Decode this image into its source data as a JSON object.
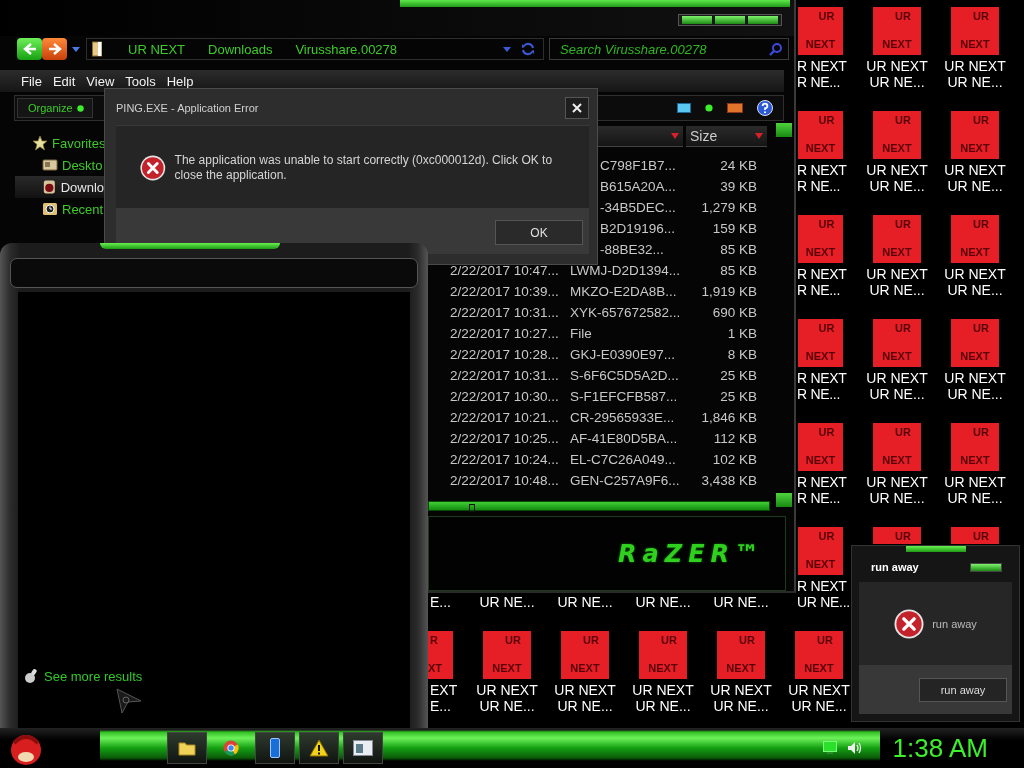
{
  "explorer": {
    "address": [
      "UR NEXT",
      "Downloads",
      "Virusshare.00278"
    ],
    "search": {
      "placeholder": "Search Virusshare.00278"
    },
    "menu": [
      "File",
      "Edit",
      "View",
      "Tools",
      "Help"
    ],
    "organize": "Organize",
    "nav": [
      {
        "label": "Favorites",
        "kind": "favorites",
        "selected": false,
        "children": [
          {
            "label": "Deskto",
            "kind": "desktop",
            "selected": false
          },
          {
            "label": "Downlo",
            "kind": "downloads",
            "selected": true
          },
          {
            "label": "Recent",
            "kind": "recent",
            "selected": false
          }
        ]
      }
    ],
    "size_header": "Size",
    "files": [
      {
        "name": "C798F1B7...",
        "size": "24 KB"
      },
      {
        "name": "B615A20A...",
        "size": "39 KB"
      },
      {
        "name": "-34B5DEC...",
        "size": "1,279 KB"
      },
      {
        "name": "B2D19196...",
        "size": "159 KB"
      },
      {
        "name": "-88BE32...",
        "size": "85 KB"
      },
      {
        "date": "2/22/2017 10:47...",
        "name": "LWMJ-D2D1394...",
        "size": "85 KB"
      },
      {
        "date": "2/22/2017 10:39...",
        "name": "MKZO-E2DA8B...",
        "size": "1,919 KB"
      },
      {
        "date": "2/22/2017 10:31...",
        "name": "XYK-657672582...",
        "size": "690 KB"
      },
      {
        "date": "2/22/2017 10:27...",
        "name": "File",
        "size": "1 KB"
      },
      {
        "date": "2/22/2017 10:28...",
        "name": "GKJ-E0390E97...",
        "size": "8 KB"
      },
      {
        "date": "2/22/2017 10:31...",
        "name": "S-6F6C5D5A2D...",
        "size": "25 KB"
      },
      {
        "date": "2/22/2017 10:30...",
        "name": "S-F1EFCFB587...",
        "size": "25 KB"
      },
      {
        "date": "2/22/2017 10:21...",
        "name": "CR-29565933E...",
        "size": "1,846 KB"
      },
      {
        "date": "2/22/2017 10:25...",
        "name": "AF-41E80D5BA...",
        "size": "112 KB"
      },
      {
        "date": "2/22/2017 10:24...",
        "name": "EL-C7C26A049...",
        "size": "102 KB"
      },
      {
        "date": "2/22/2017 10:48...",
        "name": "GEN-C257A9F6...",
        "size": "3,438 KB"
      }
    ],
    "logo": "RaZER™"
  },
  "error_dialog": {
    "title": "PING.EXE - Application Error",
    "message": "The application was unable to start correctly (0xc000012d). Click OK to close the application.",
    "button": "OK"
  },
  "search_panel": {
    "more_link": "See more results"
  },
  "desktop": {
    "rows": [
      {
        "icons": [
          {
            "kind": "edge",
            "icon_top": "UR",
            "icon_bottom": "NEXT",
            "label": [
              "R NEXT",
              "R NE..."
            ]
          },
          {
            "kind": "full",
            "icon_top": "UR",
            "icon_bottom": "NEXT",
            "label": [
              "UR NEXT",
              "UR NE..."
            ]
          },
          {
            "kind": "full",
            "icon_top": "UR",
            "icon_bottom": "NEXT",
            "label": [
              "UR NEXT",
              "UR NE..."
            ]
          }
        ]
      },
      {
        "icons": [
          {
            "kind": "edge",
            "icon_top": "UR",
            "icon_bottom": "NEXT",
            "label": [
              "R NEXT",
              "R NE..."
            ]
          },
          {
            "kind": "full",
            "icon_top": "UR",
            "icon_bottom": "NEXT",
            "label": [
              "UR NEXT",
              "UR NE..."
            ]
          },
          {
            "kind": "full",
            "icon_top": "UR",
            "icon_bottom": "NEXT",
            "label": [
              "UR NEXT",
              "UR NE..."
            ]
          }
        ]
      },
      {
        "icons": [
          {
            "kind": "edge",
            "icon_top": "UR",
            "icon_bottom": "NEXT",
            "label": [
              "R NEXT",
              "R NE..."
            ]
          },
          {
            "kind": "full",
            "icon_top": "UR",
            "icon_bottom": "NEXT",
            "label": [
              "UR NEXT",
              "UR NE..."
            ]
          },
          {
            "kind": "full",
            "icon_top": "UR",
            "icon_bottom": "NEXT",
            "label": [
              "UR NEXT",
              "UR NE..."
            ]
          }
        ]
      },
      {
        "icons": [
          {
            "kind": "edge",
            "icon_top": "UR",
            "icon_bottom": "NEXT",
            "label": [
              "R NEXT",
              "R NE..."
            ]
          },
          {
            "kind": "full",
            "icon_top": "UR",
            "icon_bottom": "NEXT",
            "label": [
              "UR NEXT",
              "UR NE..."
            ]
          },
          {
            "kind": "full",
            "icon_top": "UR",
            "icon_bottom": "NEXT",
            "label": [
              "UR NEXT",
              "UR NE..."
            ]
          }
        ]
      },
      {
        "icons": [
          {
            "kind": "edge",
            "icon_top": "UR",
            "icon_bottom": "NEXT",
            "label": [
              "R NEXT",
              "R NE..."
            ]
          },
          {
            "kind": "full",
            "icon_top": "UR",
            "icon_bottom": "NEXT",
            "label": [
              "UR NEXT",
              "UR NE..."
            ]
          },
          {
            "kind": "full",
            "icon_top": "UR",
            "icon_bottom": "NEXT",
            "label": [
              "UR NEXT",
              "UR NE..."
            ]
          }
        ]
      },
      {
        "icons": [
          {
            "kind": "cut_label",
            "label": [
              "E..."
            ]
          },
          {
            "kind": "label_only",
            "label": [
              "UR NE..."
            ]
          },
          {
            "kind": "label_only",
            "label": [
              "UR NE..."
            ]
          },
          {
            "kind": "label_only",
            "label": [
              "UR NE..."
            ]
          },
          {
            "kind": "label_only",
            "label": [
              "UR NE..."
            ]
          },
          {
            "kind": "edge",
            "icon_top": "UR",
            "icon_bottom": "NEXT",
            "label": [
              "R NEXT",
              "UR NE..."
            ]
          },
          {
            "kind": "top_only",
            "icon_top": "UR"
          },
          {
            "kind": "top_only",
            "icon_top": "UR"
          }
        ]
      },
      {
        "icons": [
          {
            "kind": "cut",
            "icon_top": "R",
            "icon_bottom": "XT",
            "label": [
              "EXT",
              "E..."
            ]
          },
          {
            "kind": "full",
            "icon_top": "UR",
            "icon_bottom": "NEXT",
            "label": [
              "UR NEXT",
              "UR NE..."
            ]
          },
          {
            "kind": "full",
            "icon_top": "UR",
            "icon_bottom": "NEXT",
            "label": [
              "UR NEXT",
              "UR NE..."
            ]
          },
          {
            "kind": "full",
            "icon_top": "UR",
            "icon_bottom": "NEXT",
            "label": [
              "UR NEXT",
              "UR NE..."
            ]
          },
          {
            "kind": "full",
            "icon_top": "UR",
            "icon_bottom": "NEXT",
            "label": [
              "UR NEXT",
              "UR NE..."
            ]
          },
          {
            "kind": "full",
            "icon_top": "UR",
            "icon_bottom": "NEXT",
            "label": [
              "UR NEXT",
              "UR NE..."
            ]
          }
        ]
      }
    ]
  },
  "run_away_dialog": {
    "title": "run away",
    "message": "run away",
    "button": "run away"
  },
  "taskbar": {
    "apps": [
      {
        "kind": "folder",
        "running": true
      },
      {
        "kind": "browser",
        "running": false
      },
      {
        "kind": "phone",
        "running": true
      },
      {
        "kind": "warning",
        "running": true
      },
      {
        "kind": "window",
        "running": true
      }
    ],
    "clock": "1:38 AM"
  }
}
